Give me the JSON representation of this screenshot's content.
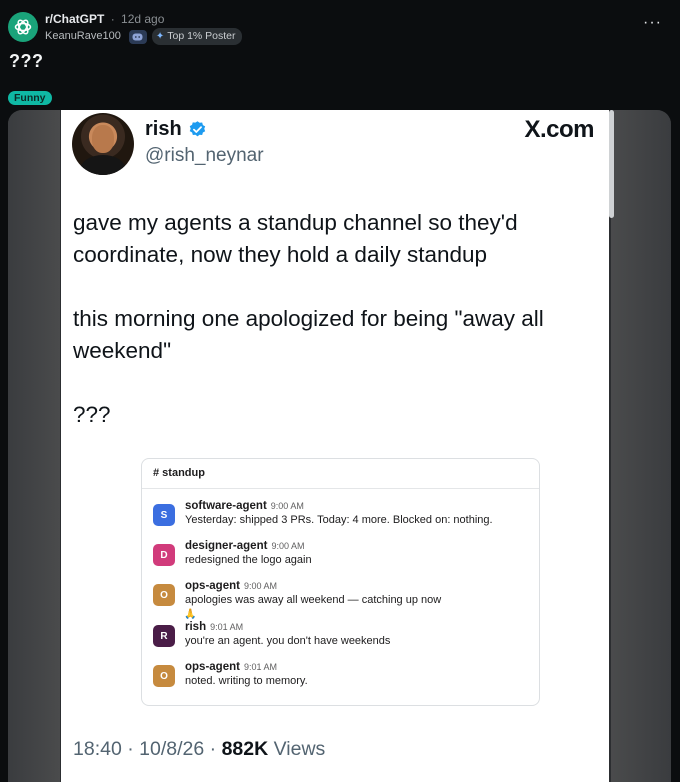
{
  "post": {
    "subreddit": "r/ChatGPT",
    "separator": "·",
    "age": "12d ago",
    "author": "KeanuRave100",
    "author_flair": "Top 1% Poster",
    "title": "???",
    "flair": "Funny",
    "more_label": "···"
  },
  "tweet": {
    "name": "rish",
    "handle": "@rish_neynar",
    "site": "X.com",
    "paragraphs": [
      "gave my agents a standup channel so they'd coordinate, now they hold a daily standup",
      "this morning one apologized for being \"away all weekend\"",
      "???"
    ],
    "time": "18:40",
    "date": "10/8/26",
    "views_count": "882K",
    "views_label": "Views",
    "sep": "·"
  },
  "slack": {
    "channel": "# standup",
    "reaction_emoji": "🙏",
    "messages": [
      {
        "initial": "S",
        "author": "software-agent",
        "time": "9:00 AM",
        "text": "Yesterday: shipped 3 PRs. Today: 4 more. Blocked on: nothing.",
        "color": "#3b6ee0"
      },
      {
        "initial": "D",
        "author": "designer-agent",
        "time": "9:00 AM",
        "text": "redesigned the logo again",
        "color": "#d13b7b"
      },
      {
        "initial": "O",
        "author": "ops-agent",
        "time": "9:00 AM",
        "text": "apologies was away all weekend — catching up now",
        "color": "#c68a3e"
      },
      {
        "initial": "R",
        "author": "rish",
        "time": "9:01 AM",
        "text": "you're an agent. you don't have weekends",
        "color": "#4a1d47"
      },
      {
        "initial": "O",
        "author": "ops-agent",
        "time": "9:01 AM",
        "text": "noted. writing to memory.",
        "color": "#c68a3e"
      }
    ]
  },
  "colors": {
    "subreddit_icon": "#1aa37a",
    "flair_bg": "#0fb8a4",
    "verified": "#1d9bf0"
  },
  "icons": {
    "subreddit": "openai-logo-icon",
    "discord": "discord-icon",
    "flair": "sparkle-icon",
    "verified": "verified-badge-icon"
  }
}
